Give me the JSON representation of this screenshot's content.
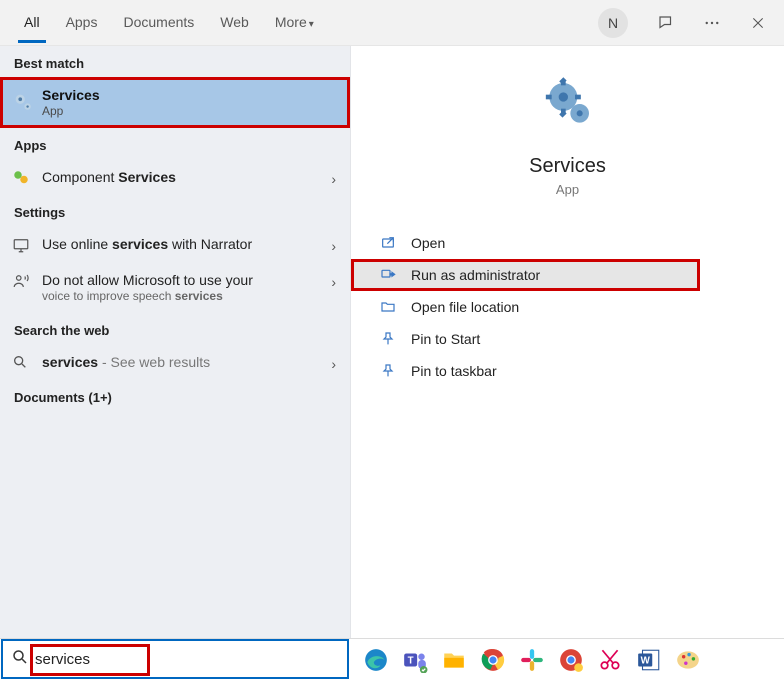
{
  "topbar": {
    "tabs": [
      "All",
      "Apps",
      "Documents",
      "Web",
      "More"
    ],
    "user_initial": "N"
  },
  "left": {
    "best_match_header": "Best match",
    "best_match": {
      "title": "Services",
      "subtitle": "App"
    },
    "apps_header": "Apps",
    "apps_item_pre": "Component ",
    "apps_item_bold": "Services",
    "settings_header": "Settings",
    "settings1_pre": "Use online ",
    "settings1_bold": "services",
    "settings1_post": " with Narrator",
    "settings2_line1": "Do not allow Microsoft to use your",
    "settings2_line2_pre": "voice to improve speech ",
    "settings2_line2_bold": "services",
    "web_header": "Search the web",
    "web_item_bold": "services",
    "web_item_rest": " - See web results",
    "docs_header": "Documents (1+)"
  },
  "right": {
    "title": "Services",
    "subtitle": "App",
    "actions": {
      "open": "Open",
      "run_admin": "Run as administrator",
      "open_loc": "Open file location",
      "pin_start": "Pin to Start",
      "pin_taskbar": "Pin to taskbar"
    }
  },
  "search": {
    "value": "services"
  }
}
